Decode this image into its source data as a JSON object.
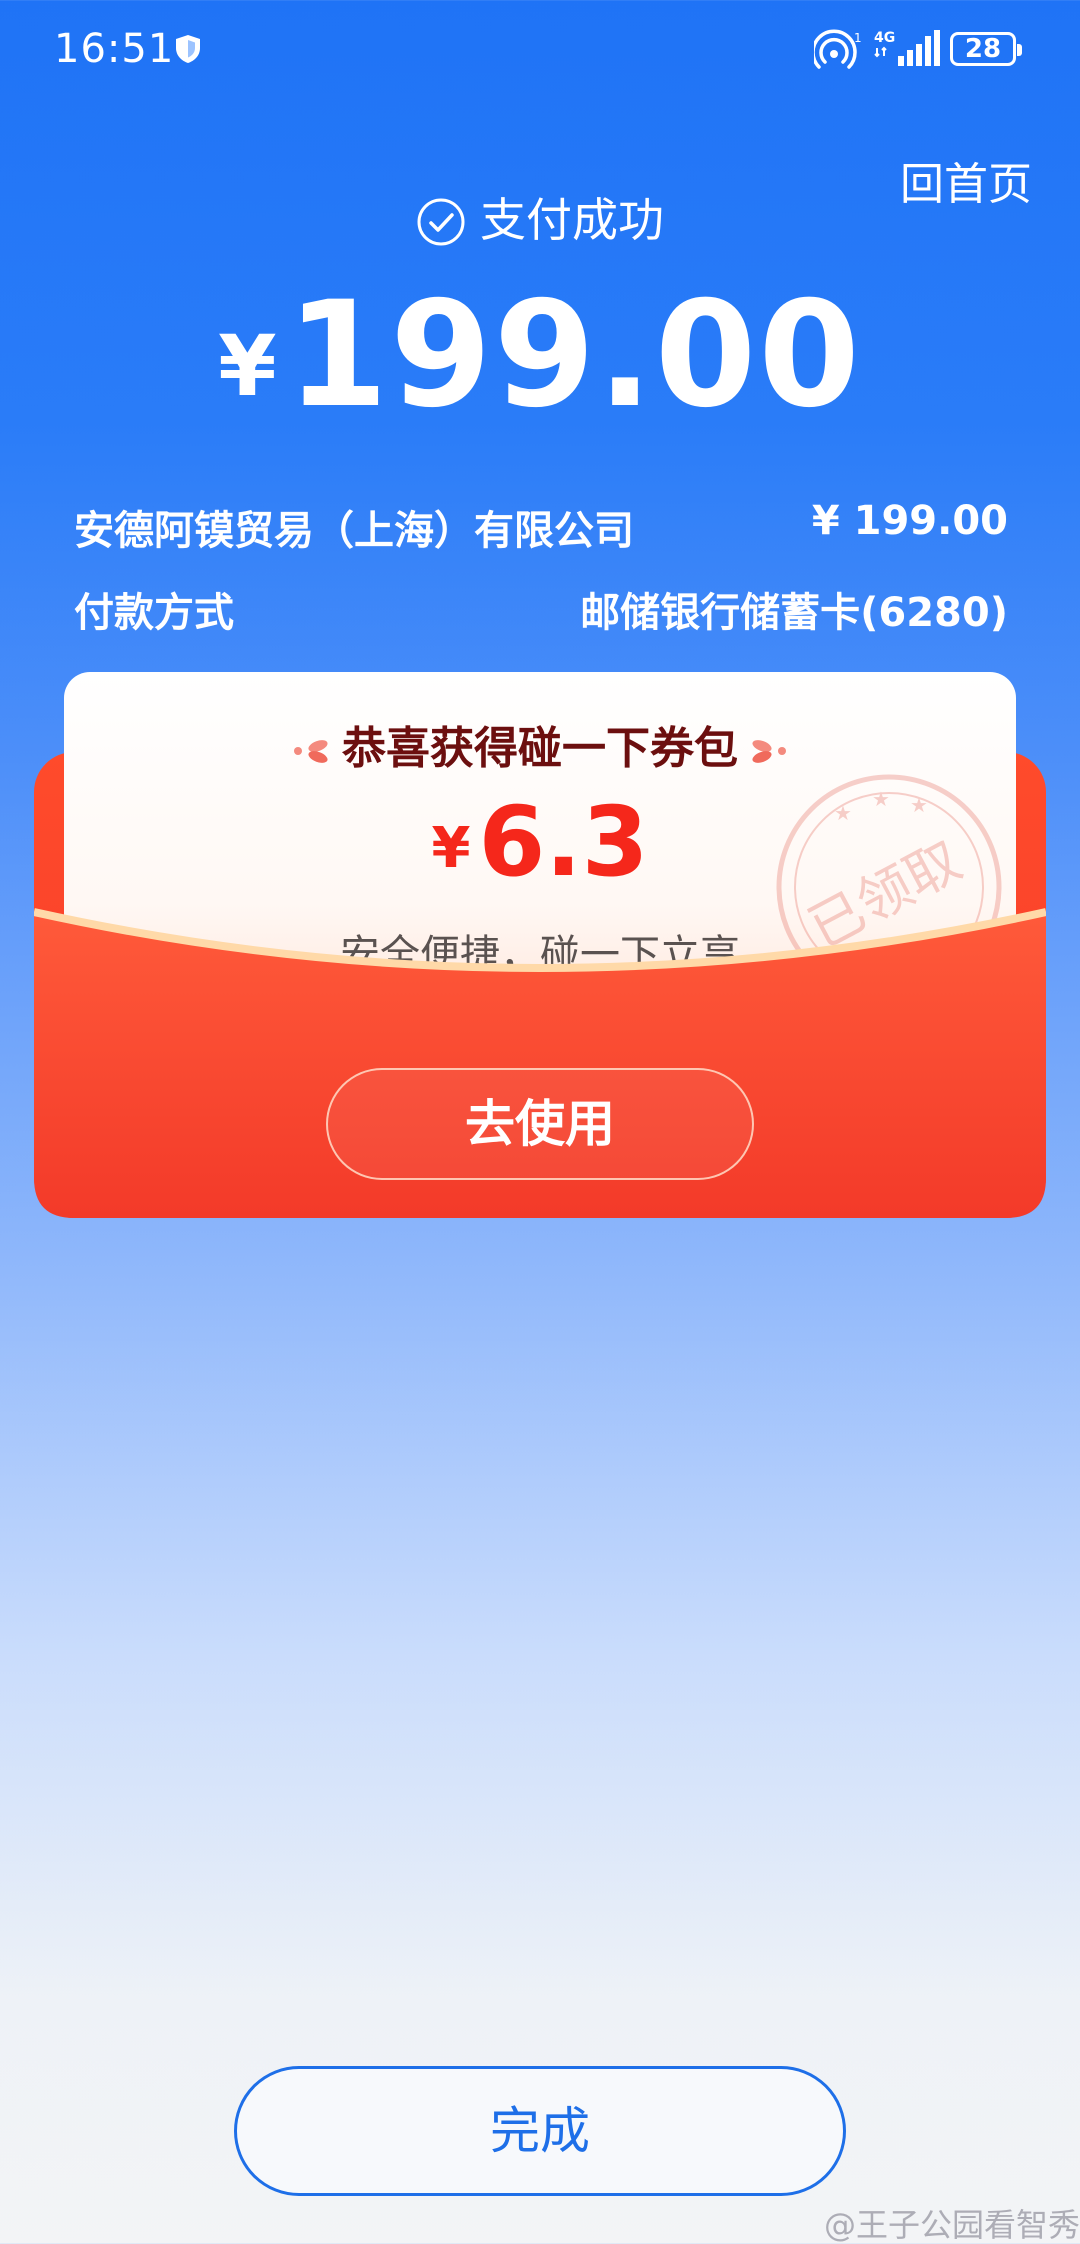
{
  "status_bar": {
    "time": "16:51",
    "battery": "28"
  },
  "header": {
    "home_label": "回首页",
    "status_text": "支付成功",
    "currency_symbol": "¥",
    "amount": "199.00"
  },
  "details": {
    "merchant": "安德阿镆贸易（上海）有限公司",
    "merchant_amount": "¥ 199.00",
    "payment_method_label": "付款方式",
    "payment_method_value": "邮储银行储蓄卡(6280)"
  },
  "coupon": {
    "title": "恭喜获得碰一下券包",
    "currency_symbol": "¥",
    "amount": "6.3",
    "subtitle": "安全便捷，碰一下立享",
    "stamp_text": "已领取",
    "use_button": "去使用"
  },
  "footer": {
    "done_button": "完成",
    "watermark": "@王子公园看智秀"
  },
  "colors": {
    "header_blue": "#1f73f6",
    "coupon_red": "#f53a2a",
    "coupon_amount": "#f5271b",
    "button_blue": "#1e6fe8"
  }
}
